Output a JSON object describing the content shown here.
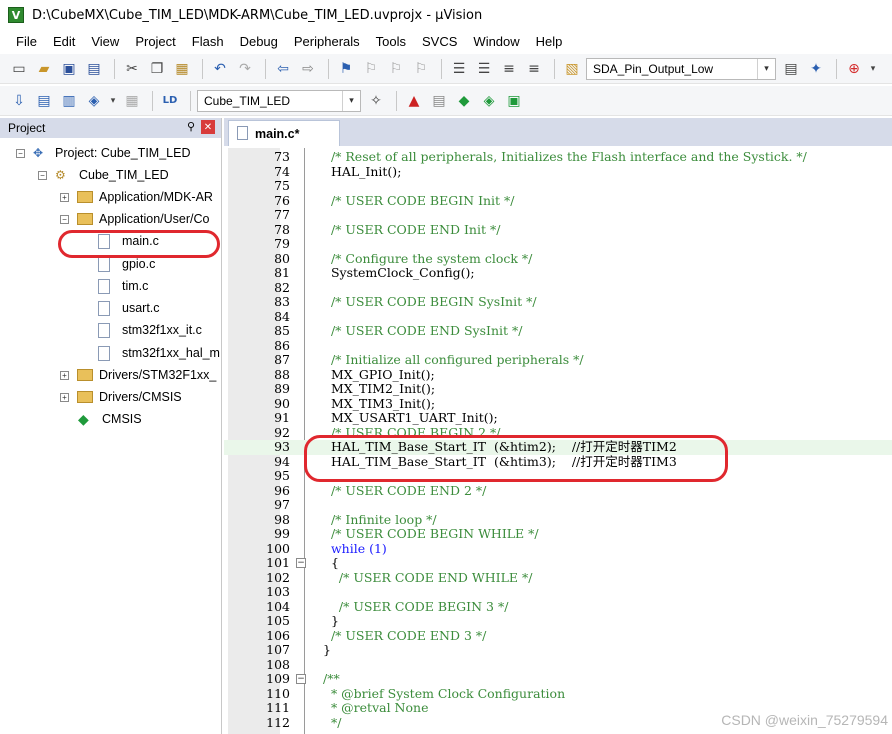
{
  "window": {
    "title": "D:\\CubeMX\\Cube_TIM_LED\\MDK-ARM\\Cube_TIM_LED.uvprojx - µVision"
  },
  "menu": [
    "File",
    "Edit",
    "View",
    "Project",
    "Flash",
    "Debug",
    "Peripherals",
    "Tools",
    "SVCS",
    "Window",
    "Help"
  ],
  "toolbar1": {
    "find_combo": "SDA_Pin_Output_Low"
  },
  "toolbar2": {
    "target_combo": "Cube_TIM_LED"
  },
  "project": {
    "header": "Project",
    "root": "Project: Cube_TIM_LED",
    "target": "Cube_TIM_LED",
    "groups": [
      {
        "label": "Application/MDK-AR",
        "expanded": false
      },
      {
        "label": "Application/User/Co",
        "expanded": true,
        "files": [
          "main.c",
          "gpio.c",
          "tim.c",
          "usart.c",
          "stm32f1xx_it.c",
          "stm32f1xx_hal_m"
        ]
      },
      {
        "label": "Drivers/STM32F1xx_",
        "expanded": false
      },
      {
        "label": "Drivers/CMSIS",
        "expanded": false
      }
    ],
    "cmsis": "CMSIS"
  },
  "editor": {
    "tab": "main.c*",
    "lines": [
      {
        "n": "73",
        "t": "  /* Reset of all peripherals, Initializes the Flash interface and the Systick. */",
        "k": "c"
      },
      {
        "n": "74",
        "t": "  HAL_Init();",
        "k": ""
      },
      {
        "n": "75",
        "t": "",
        "k": ""
      },
      {
        "n": "76",
        "t": "  /* USER CODE BEGIN Init */",
        "k": "c"
      },
      {
        "n": "77",
        "t": "",
        "k": ""
      },
      {
        "n": "78",
        "t": "  /* USER CODE END Init */",
        "k": "c"
      },
      {
        "n": "79",
        "t": "",
        "k": ""
      },
      {
        "n": "80",
        "t": "  /* Configure the system clock */",
        "k": "c"
      },
      {
        "n": "81",
        "t": "  SystemClock_Config();",
        "k": ""
      },
      {
        "n": "82",
        "t": "",
        "k": ""
      },
      {
        "n": "83",
        "t": "  /* USER CODE BEGIN SysInit */",
        "k": "c"
      },
      {
        "n": "84",
        "t": "",
        "k": ""
      },
      {
        "n": "85",
        "t": "  /* USER CODE END SysInit */",
        "k": "c"
      },
      {
        "n": "86",
        "t": "",
        "k": ""
      },
      {
        "n": "87",
        "t": "  /* Initialize all configured peripherals */",
        "k": "c"
      },
      {
        "n": "88",
        "t": "  MX_GPIO_Init();",
        "k": ""
      },
      {
        "n": "89",
        "t": "  MX_TIM2_Init();",
        "k": ""
      },
      {
        "n": "90",
        "t": "  MX_TIM3_Init();",
        "k": ""
      },
      {
        "n": "91",
        "t": "  MX_USART1_UART_Init();",
        "k": ""
      },
      {
        "n": "92",
        "t": "  /* USER CODE BEGIN 2 */",
        "k": "c"
      },
      {
        "n": "93",
        "t": "  HAL_TIM_Base_Start_IT  (&htim2);    //打开定时器TIM2",
        "k": "hl"
      },
      {
        "n": "94",
        "t": "  HAL_TIM_Base_Start_IT  (&htim3);    //打开定时器TIM3",
        "k": ""
      },
      {
        "n": "95",
        "t": "",
        "k": ""
      },
      {
        "n": "96",
        "t": "  /* USER CODE END 2 */",
        "k": "c"
      },
      {
        "n": "97",
        "t": "",
        "k": ""
      },
      {
        "n": "98",
        "t": "  /* Infinite loop */",
        "k": "c"
      },
      {
        "n": "99",
        "t": "  /* USER CODE BEGIN WHILE */",
        "k": "c"
      },
      {
        "n": "100",
        "t": "  while (1)",
        "k": "kw"
      },
      {
        "n": "101",
        "t": "  {",
        "k": ""
      },
      {
        "n": "102",
        "t": "    /* USER CODE END WHILE */",
        "k": "c"
      },
      {
        "n": "103",
        "t": "",
        "k": ""
      },
      {
        "n": "104",
        "t": "    /* USER CODE BEGIN 3 */",
        "k": "c"
      },
      {
        "n": "105",
        "t": "  }",
        "k": ""
      },
      {
        "n": "106",
        "t": "  /* USER CODE END 3 */",
        "k": "c"
      },
      {
        "n": "107",
        "t": "}",
        "k": ""
      },
      {
        "n": "108",
        "t": "",
        "k": ""
      },
      {
        "n": "109",
        "t": "/**",
        "k": "c"
      },
      {
        "n": "110",
        "t": "  * @brief System Clock Configuration",
        "k": "c"
      },
      {
        "n": "111",
        "t": "  * @retval None",
        "k": "c"
      },
      {
        "n": "112",
        "t": "  */",
        "k": "c"
      }
    ]
  },
  "watermark": "CSDN @weixin_75279594",
  "colors": {
    "comment": "#3b8c3b",
    "keyword": "#1a1aff",
    "annotation": "#e0282e",
    "panel_header": "#d6dbe9"
  }
}
